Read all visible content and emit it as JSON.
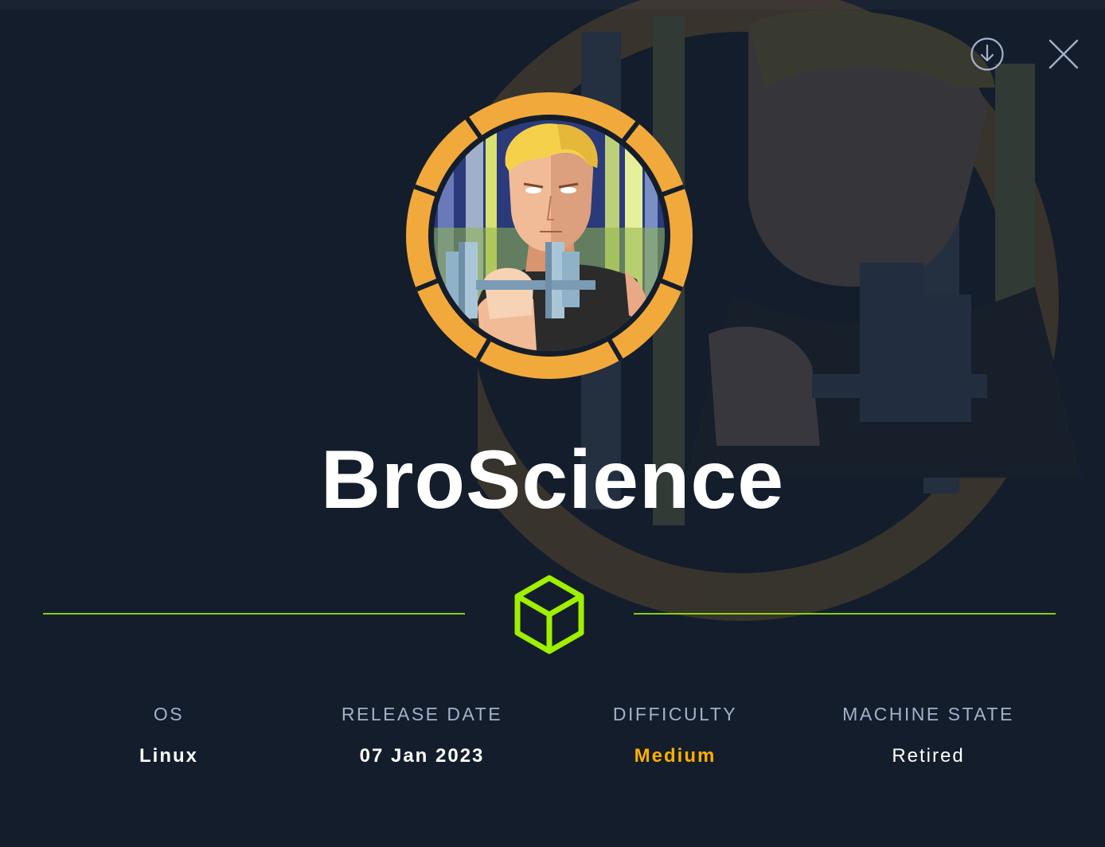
{
  "machine": {
    "name": "BroScience"
  },
  "toolbar": {
    "download_icon": "download-circle-icon",
    "close_icon": "close-x-icon"
  },
  "info": {
    "os_label": "OS",
    "os_value": "Linux",
    "release_label": "RELEASE DATE",
    "release_value": "07 Jan 2023",
    "difficulty_label": "DIFFICULTY",
    "difficulty_value": "Medium",
    "state_label": "MACHINE STATE",
    "state_value": "Retired"
  },
  "colors": {
    "background": "#141d2b",
    "accent_green": "#9fef00",
    "difficulty_medium": "#ffaf00",
    "ring_orange": "#f2a93b",
    "label_gray": "#a4b1cd"
  }
}
